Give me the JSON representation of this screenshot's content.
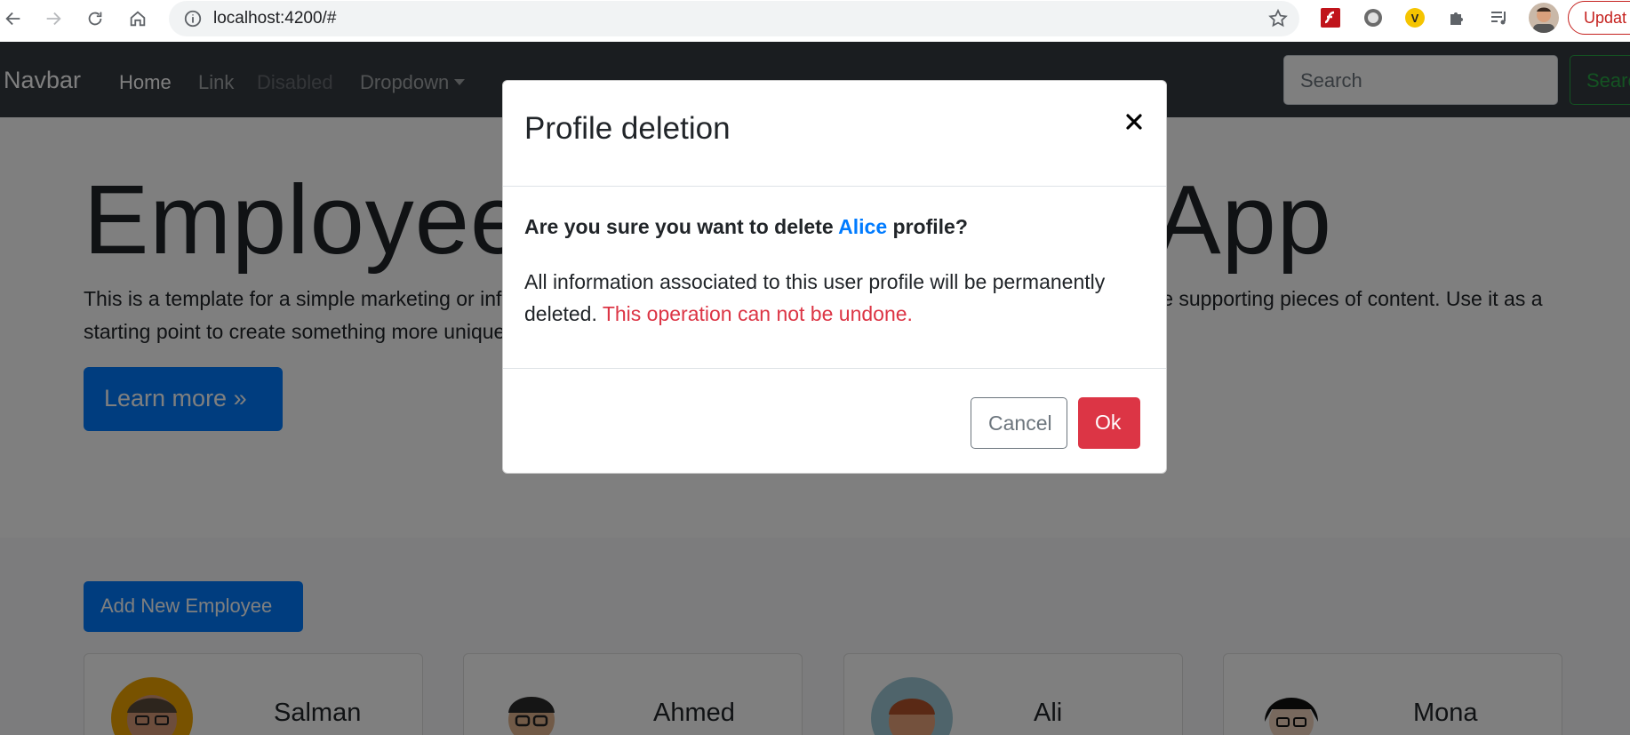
{
  "browser": {
    "url": "localhost:4200/#",
    "update_label": "Updat"
  },
  "navbar": {
    "brand": "Navbar",
    "links": [
      {
        "label": "Home"
      },
      {
        "label": "Link"
      },
      {
        "label": "Disabled"
      },
      {
        "label": "Dropdown"
      }
    ],
    "search_placeholder": "Search",
    "search_button": "Searc"
  },
  "jumbotron": {
    "title": "Employee Management App",
    "text": "This is a template for a simple marketing or informational website. It includes a large callout called a jumbotron and three supporting pieces of content. Use it as a starting point to create something more unique.",
    "button": "Learn more »"
  },
  "employees": {
    "add_button": "Add New Employee",
    "cards": [
      {
        "name": "Salman"
      },
      {
        "name": "Ahmed"
      },
      {
        "name": "Ali"
      },
      {
        "name": "Mona"
      }
    ]
  },
  "modal": {
    "title": "Profile deletion",
    "question_prefix": "Are you sure you want to delete ",
    "question_name": "Alice",
    "question_suffix": " profile?",
    "info": "All information associated to this user profile will be permanently deleted. ",
    "warning": "This operation can not be undone.",
    "cancel": "Cancel",
    "ok": "Ok"
  },
  "colors": {
    "primary": "#007bff",
    "danger": "#dc3545",
    "success": "#28a745",
    "navbar": "#343a40"
  }
}
